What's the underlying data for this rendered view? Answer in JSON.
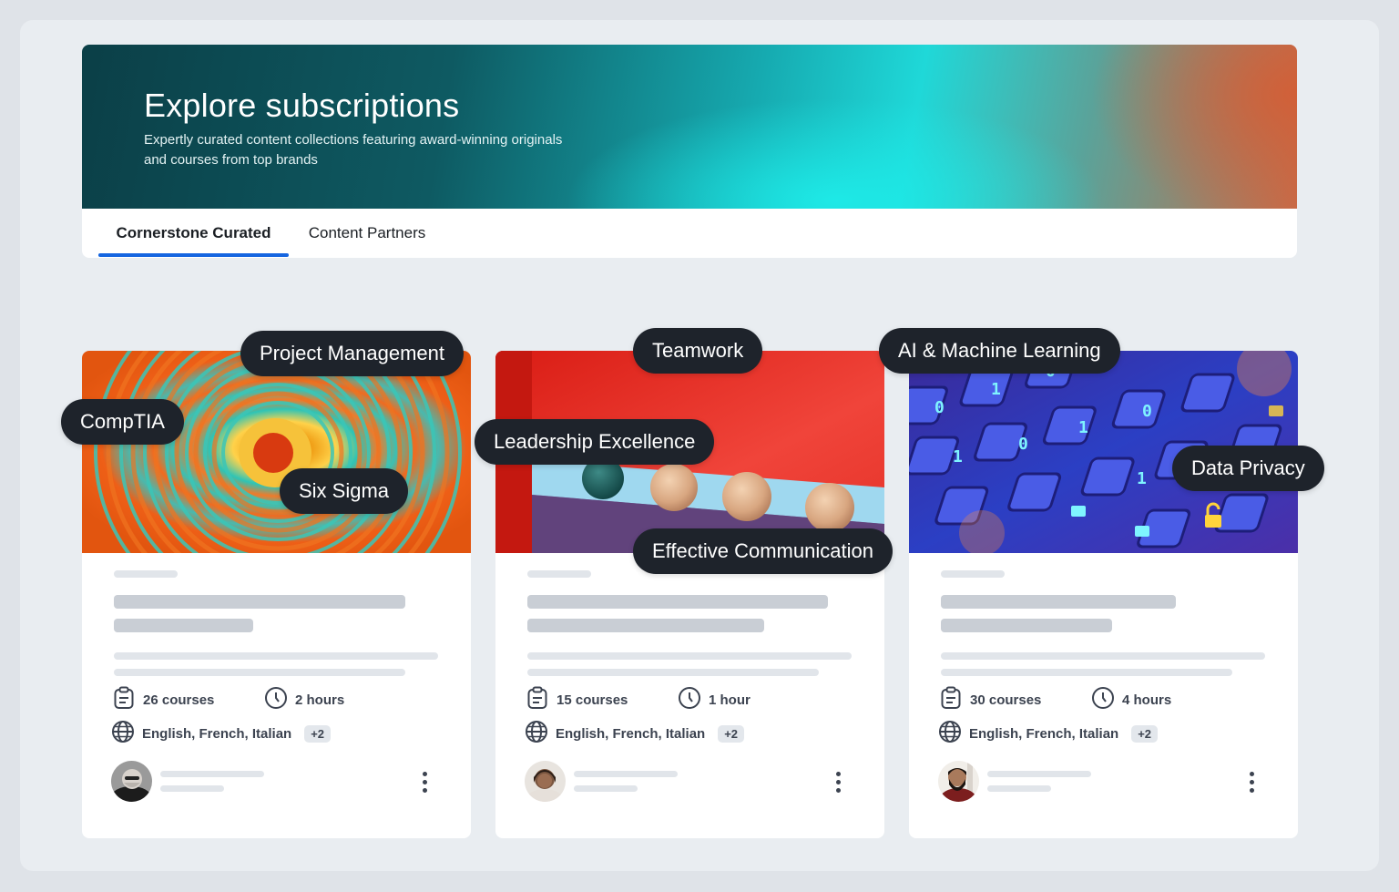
{
  "header": {
    "title": "Explore subscriptions",
    "subtitle_line1": "Expertly curated content collections featuring award-winning originals",
    "subtitle_line2": "and courses from top brands"
  },
  "tabs": [
    {
      "label": "Cornerstone Curated",
      "active": true
    },
    {
      "label": "Content Partners",
      "active": false
    }
  ],
  "cards": [
    {
      "courses": "26 courses",
      "duration": "2 hours",
      "languages": "English, French, Italian",
      "extra_languages": "+2",
      "image": "orange-teal-rings"
    },
    {
      "courses": "15 courses",
      "duration": "1 hour",
      "languages": "English, French, Italian",
      "extra_languages": "+2",
      "image": "wooden-balls-red-wall"
    },
    {
      "courses": "30 courses",
      "duration": "4 hours",
      "languages": "English, French, Italian",
      "extra_languages": "+2",
      "image": "blue-keyboard-locks"
    }
  ],
  "topics": {
    "project_management": "Project Management",
    "comptia": "CompTIA",
    "six_sigma": "Six Sigma",
    "teamwork": "Teamwork",
    "leadership": "Leadership Excellence",
    "communication": "Effective Communication",
    "ai_ml": "AI & Machine Learning",
    "data_privacy": "Data Privacy"
  },
  "colors": {
    "accent": "#1565e0",
    "pill_bg": "#1e232b",
    "skeleton": "#c9ced5",
    "page_bg": "#e9edf1"
  },
  "icons": {
    "courses": "clipboard-icon",
    "duration": "clock-icon",
    "language": "globe-icon",
    "menu": "kebab-menu-icon"
  }
}
